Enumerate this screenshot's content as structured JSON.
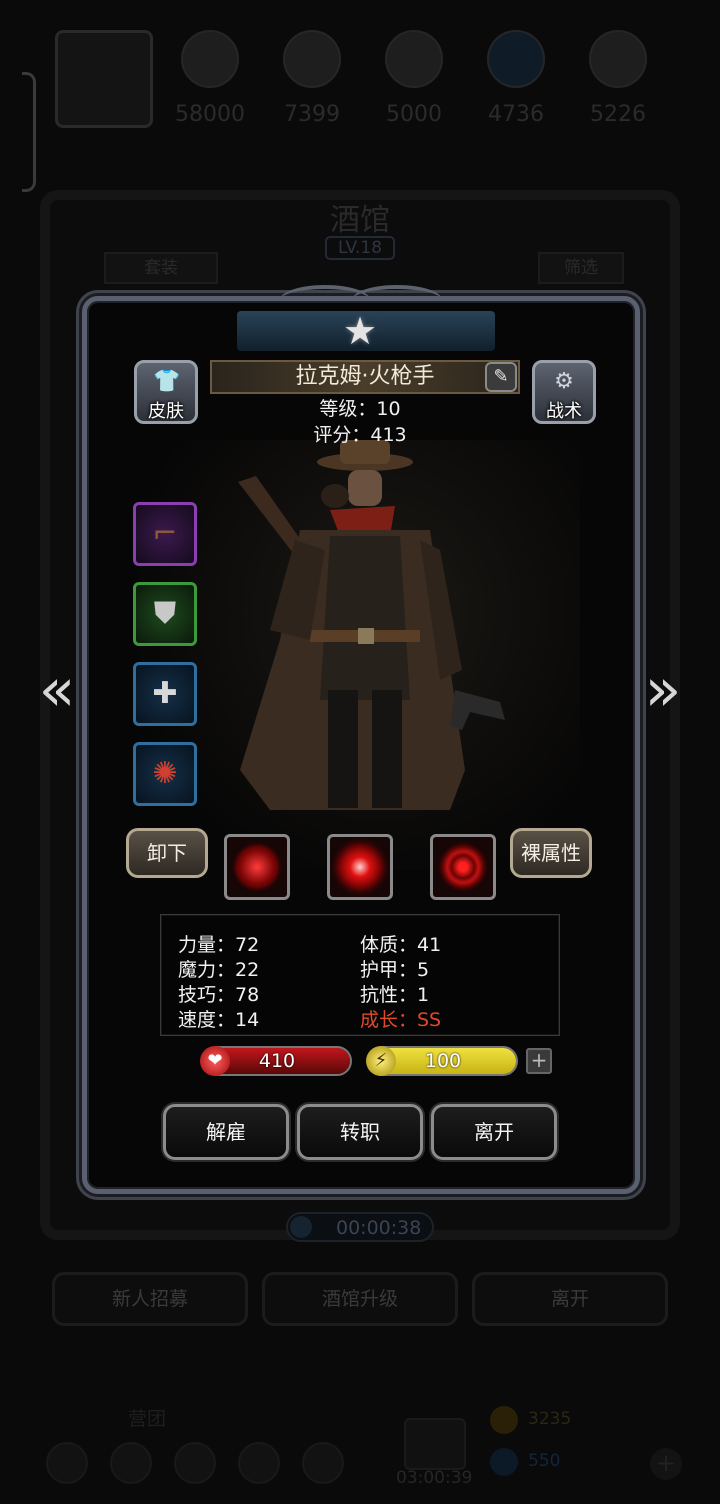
{
  "top_resources": {
    "values": [
      "58000",
      "7399",
      "5000",
      "4736",
      "5226"
    ],
    "icons": [
      "meat-orb-icon",
      "bread-orb-icon",
      "ore-orb-icon",
      "crystal-orb-icon",
      "wood-orb-icon"
    ]
  },
  "tavern": {
    "title": "酒馆",
    "level": "LV.18",
    "tab_set": "套装",
    "tab_filter": "筛选",
    "timer": "00:00:38",
    "buttons": {
      "recruit": "新人招募",
      "upgrade": "酒馆升级",
      "leave": "离开"
    }
  },
  "bottom_bar": {
    "label": "营团",
    "gift_timer": "03:00:39",
    "res1": "3235",
    "res2": "550"
  },
  "hero": {
    "name": "拉克姆·火枪手",
    "level_line": "等级：10",
    "score_line": "评分：413",
    "skin_label": "皮肤",
    "tactics_label": "战术",
    "unequip_label": "卸下",
    "naked_attr_label": "裸属性",
    "equipment": [
      {
        "name": "rifle-icon",
        "rarity_color": "#8a3fb0"
      },
      {
        "name": "armor-icon",
        "rarity_color": "#3c9a3c"
      },
      {
        "name": "amulet-icon",
        "rarity_color": "#2f6f9e"
      },
      {
        "name": "ring-icon",
        "rarity_color": "#2f6f9e"
      }
    ],
    "skills": [
      "crosshair-skill-icon",
      "vortex-skill-icon",
      "target-skill-icon"
    ],
    "attributes": {
      "strength": "力量：72",
      "magic": "魔力：22",
      "skill": "技巧：78",
      "speed": "速度：14",
      "constitution": "体质：41",
      "armor": "护甲：5",
      "resistance": "抗性：1",
      "growth": "成长：SS"
    },
    "hp": {
      "value": "410",
      "fill": 1.0,
      "color": "#c2161b"
    },
    "energy": {
      "value": "100",
      "fill": 1.0,
      "color": "#c8b413"
    },
    "actions": {
      "dismiss": "解雇",
      "transfer": "转职",
      "leave": "离开"
    }
  }
}
